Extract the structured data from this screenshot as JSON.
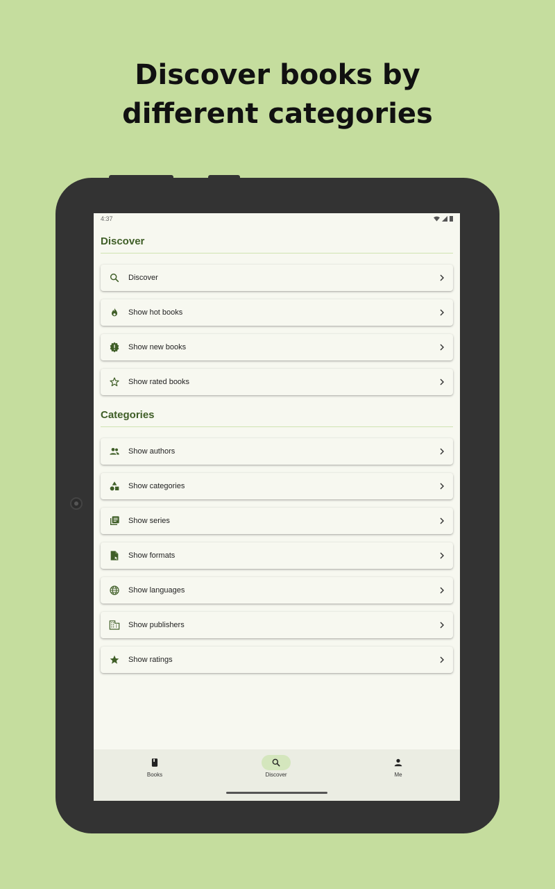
{
  "headline": {
    "line1": "Discover books by",
    "line2": "different categories"
  },
  "status": {
    "time": "4:37"
  },
  "discover": {
    "title": "Discover",
    "items": [
      {
        "label": "Discover",
        "icon": "search-icon"
      },
      {
        "label": "Show hot books",
        "icon": "fire-icon"
      },
      {
        "label": "Show new books",
        "icon": "new-badge-icon"
      },
      {
        "label": "Show rated books",
        "icon": "star-outline-icon"
      }
    ]
  },
  "categories": {
    "title": "Categories",
    "items": [
      {
        "label": "Show authors",
        "icon": "people-icon"
      },
      {
        "label": "Show categories",
        "icon": "shapes-icon"
      },
      {
        "label": "Show series",
        "icon": "library-icon"
      },
      {
        "label": "Show formats",
        "icon": "file-icon"
      },
      {
        "label": "Show languages",
        "icon": "globe-icon"
      },
      {
        "label": "Show publishers",
        "icon": "building-icon"
      },
      {
        "label": "Show ratings",
        "icon": "star-icon"
      }
    ]
  },
  "nav": [
    {
      "label": "Books",
      "icon": "book-icon",
      "active": false
    },
    {
      "label": "Discover",
      "icon": "search-icon",
      "active": true
    },
    {
      "label": "Me",
      "icon": "person-icon",
      "active": false
    }
  ],
  "colors": {
    "background": "#c5dd9e",
    "accent": "#3f5e27",
    "device": "#333333"
  }
}
